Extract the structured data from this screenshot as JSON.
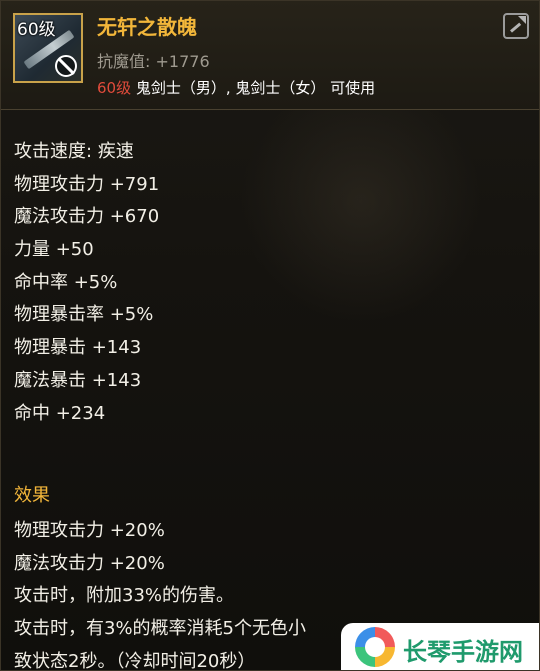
{
  "header": {
    "level_badge": "60级",
    "item_name": "无轩之散魄",
    "resist_label": "抗魔值:",
    "resist_value": "+1776",
    "req_level": "60级",
    "req_classes": " 鬼剑士（男）, 鬼剑士（女） 可使用"
  },
  "stats": [
    "攻击速度: 疾速",
    "物理攻击力 +791",
    "魔法攻击力 +670",
    "力量 +50",
    "命中率 +5%",
    "物理暴击率 +5%",
    "物理暴击 +143",
    "魔法暴击 +143",
    "命中 +234"
  ],
  "effects": {
    "title": "效果",
    "lines": [
      "物理攻击力 +20%",
      "魔法攻击力 +20%",
      "攻击时，附加33%的伤害。",
      "攻击时，有3%的概率消耗5个无色小",
      "致状态2秒。（冷却时间20秒）"
    ]
  },
  "watermark": {
    "text": "长琴手游网"
  },
  "colors": {
    "item_name": "#f2b63a",
    "req_level": "#e14b3b",
    "effect_title": "#f2b63a",
    "watermark_text": "#1f9a6c"
  },
  "icons": [
    "weapon-icon",
    "forbidden-icon",
    "share-icon",
    "watermark-logo"
  ]
}
